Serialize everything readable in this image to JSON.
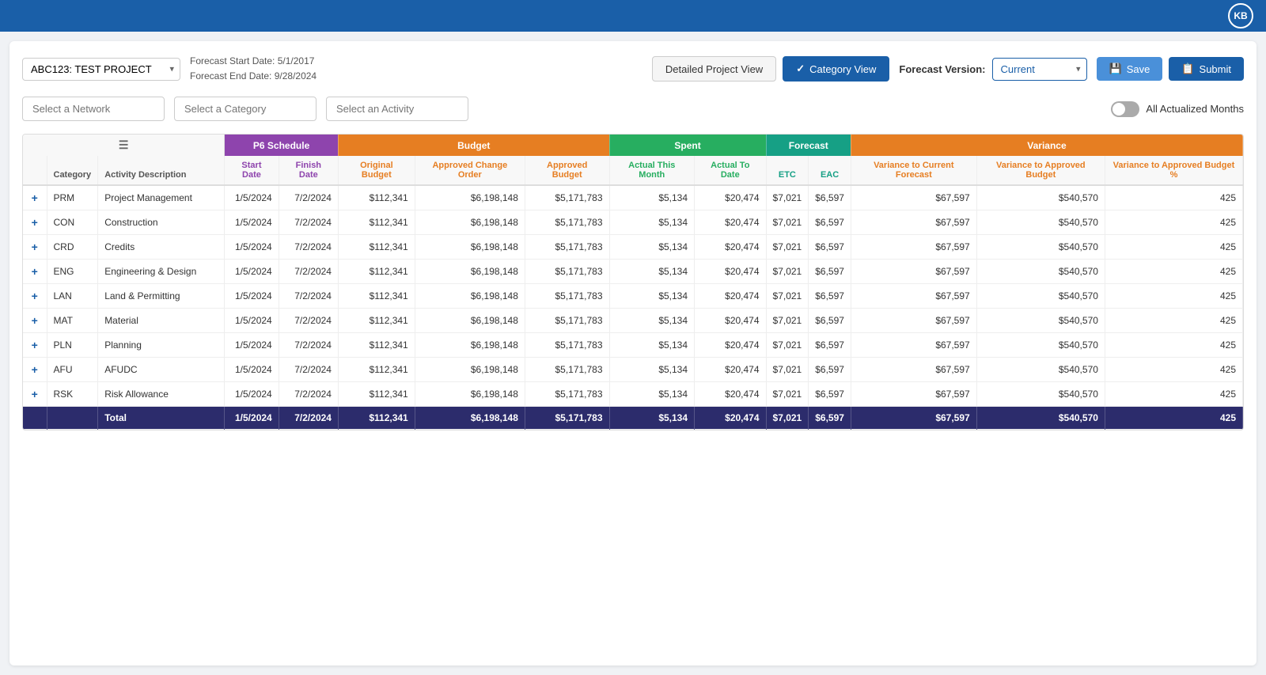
{
  "topbar": {
    "avatar_initials": "KB"
  },
  "project": {
    "label": "ABC123: TEST PROJECT",
    "forecast_start": "Forecast Start Date: 5/1/2017",
    "forecast_end": "Forecast End Date: 9/28/2024"
  },
  "views": {
    "detailed": "Detailed Project View",
    "category": "Category View"
  },
  "forecast_version": {
    "label": "Forecast Version:",
    "value": "Current"
  },
  "buttons": {
    "save": "Save",
    "submit": "Submit"
  },
  "filters": {
    "network_placeholder": "Select a Network",
    "category_placeholder": "Select a Category",
    "activity_placeholder": "Select an Activity",
    "toggle_label": "All Actualized Months"
  },
  "table": {
    "group_headers": {
      "p6": "P6 Schedule",
      "budget": "Budget",
      "spent": "Spent",
      "forecast": "Forecast",
      "variance": "Variance"
    },
    "sub_headers": {
      "category": "Category",
      "activity_desc": "Activity Description",
      "start_date": "Start Date",
      "finish_date": "Finish Date",
      "original_budget": "Original Budget",
      "approved_change_order": "Approved Change Order",
      "approved_budget": "Approved Budget",
      "actual_this_month": "Actual This Month",
      "actual_to_date": "Actual To Date",
      "etc": "ETC",
      "eac": "EAC",
      "variance_current": "Variance to Current Forecast",
      "variance_approved": "Variance to Approved Budget",
      "variance_approved2": "Variance to Approved Budget %"
    },
    "rows": [
      {
        "expand": "+",
        "category": "PRM",
        "desc": "Project Management",
        "start": "1/5/2024",
        "finish": "7/2/2024",
        "orig_budget": "$112,341",
        "approved_co": "$6,198,148",
        "approved_bud": "$5,171,783",
        "actual_month": "$5,134",
        "actual_date": "$20,474",
        "etc": "$7,021",
        "eac": "$6,597",
        "var_current": "$67,597",
        "var_approved": "$540,570",
        "var_approved2": "425"
      },
      {
        "expand": "+",
        "category": "CON",
        "desc": "Construction",
        "start": "1/5/2024",
        "finish": "7/2/2024",
        "orig_budget": "$112,341",
        "approved_co": "$6,198,148",
        "approved_bud": "$5,171,783",
        "actual_month": "$5,134",
        "actual_date": "$20,474",
        "etc": "$7,021",
        "eac": "$6,597",
        "var_current": "$67,597",
        "var_approved": "$540,570",
        "var_approved2": "425"
      },
      {
        "expand": "+",
        "category": "CRD",
        "desc": "Credits",
        "start": "1/5/2024",
        "finish": "7/2/2024",
        "orig_budget": "$112,341",
        "approved_co": "$6,198,148",
        "approved_bud": "$5,171,783",
        "actual_month": "$5,134",
        "actual_date": "$20,474",
        "etc": "$7,021",
        "eac": "$6,597",
        "var_current": "$67,597",
        "var_approved": "$540,570",
        "var_approved2": "425"
      },
      {
        "expand": "+",
        "category": "ENG",
        "desc": "Engineering & Design",
        "start": "1/5/2024",
        "finish": "7/2/2024",
        "orig_budget": "$112,341",
        "approved_co": "$6,198,148",
        "approved_bud": "$5,171,783",
        "actual_month": "$5,134",
        "actual_date": "$20,474",
        "etc": "$7,021",
        "eac": "$6,597",
        "var_current": "$67,597",
        "var_approved": "$540,570",
        "var_approved2": "425"
      },
      {
        "expand": "+",
        "category": "LAN",
        "desc": "Land & Permitting",
        "start": "1/5/2024",
        "finish": "7/2/2024",
        "orig_budget": "$112,341",
        "approved_co": "$6,198,148",
        "approved_bud": "$5,171,783",
        "actual_month": "$5,134",
        "actual_date": "$20,474",
        "etc": "$7,021",
        "eac": "$6,597",
        "var_current": "$67,597",
        "var_approved": "$540,570",
        "var_approved2": "425"
      },
      {
        "expand": "+",
        "category": "MAT",
        "desc": "Material",
        "start": "1/5/2024",
        "finish": "7/2/2024",
        "orig_budget": "$112,341",
        "approved_co": "$6,198,148",
        "approved_bud": "$5,171,783",
        "actual_month": "$5,134",
        "actual_date": "$20,474",
        "etc": "$7,021",
        "eac": "$6,597",
        "var_current": "$67,597",
        "var_approved": "$540,570",
        "var_approved2": "425"
      },
      {
        "expand": "+",
        "category": "PLN",
        "desc": "Planning",
        "start": "1/5/2024",
        "finish": "7/2/2024",
        "orig_budget": "$112,341",
        "approved_co": "$6,198,148",
        "approved_bud": "$5,171,783",
        "actual_month": "$5,134",
        "actual_date": "$20,474",
        "etc": "$7,021",
        "eac": "$6,597",
        "var_current": "$67,597",
        "var_approved": "$540,570",
        "var_approved2": "425"
      },
      {
        "expand": "+",
        "category": "AFU",
        "desc": "AFUDC",
        "start": "1/5/2024",
        "finish": "7/2/2024",
        "orig_budget": "$112,341",
        "approved_co": "$6,198,148",
        "approved_bud": "$5,171,783",
        "actual_month": "$5,134",
        "actual_date": "$20,474",
        "etc": "$7,021",
        "eac": "$6,597",
        "var_current": "$67,597",
        "var_approved": "$540,570",
        "var_approved2": "425"
      },
      {
        "expand": "+",
        "category": "RSK",
        "desc": "Risk Allowance",
        "start": "1/5/2024",
        "finish": "7/2/2024",
        "orig_budget": "$112,341",
        "approved_co": "$6,198,148",
        "approved_bud": "$5,171,783",
        "actual_month": "$5,134",
        "actual_date": "$20,474",
        "etc": "$7,021",
        "eac": "$6,597",
        "var_current": "$67,597",
        "var_approved": "$540,570",
        "var_approved2": "425"
      }
    ],
    "total": {
      "label": "Total",
      "start": "1/5/2024",
      "finish": "7/2/2024",
      "orig_budget": "$112,341",
      "approved_co": "$6,198,148",
      "approved_bud": "$5,171,783",
      "actual_month": "$5,134",
      "actual_date": "$20,474",
      "etc": "$7,021",
      "eac": "$6,597",
      "var_current": "$67,597",
      "var_approved": "$540,570",
      "var_approved2": "425"
    }
  }
}
